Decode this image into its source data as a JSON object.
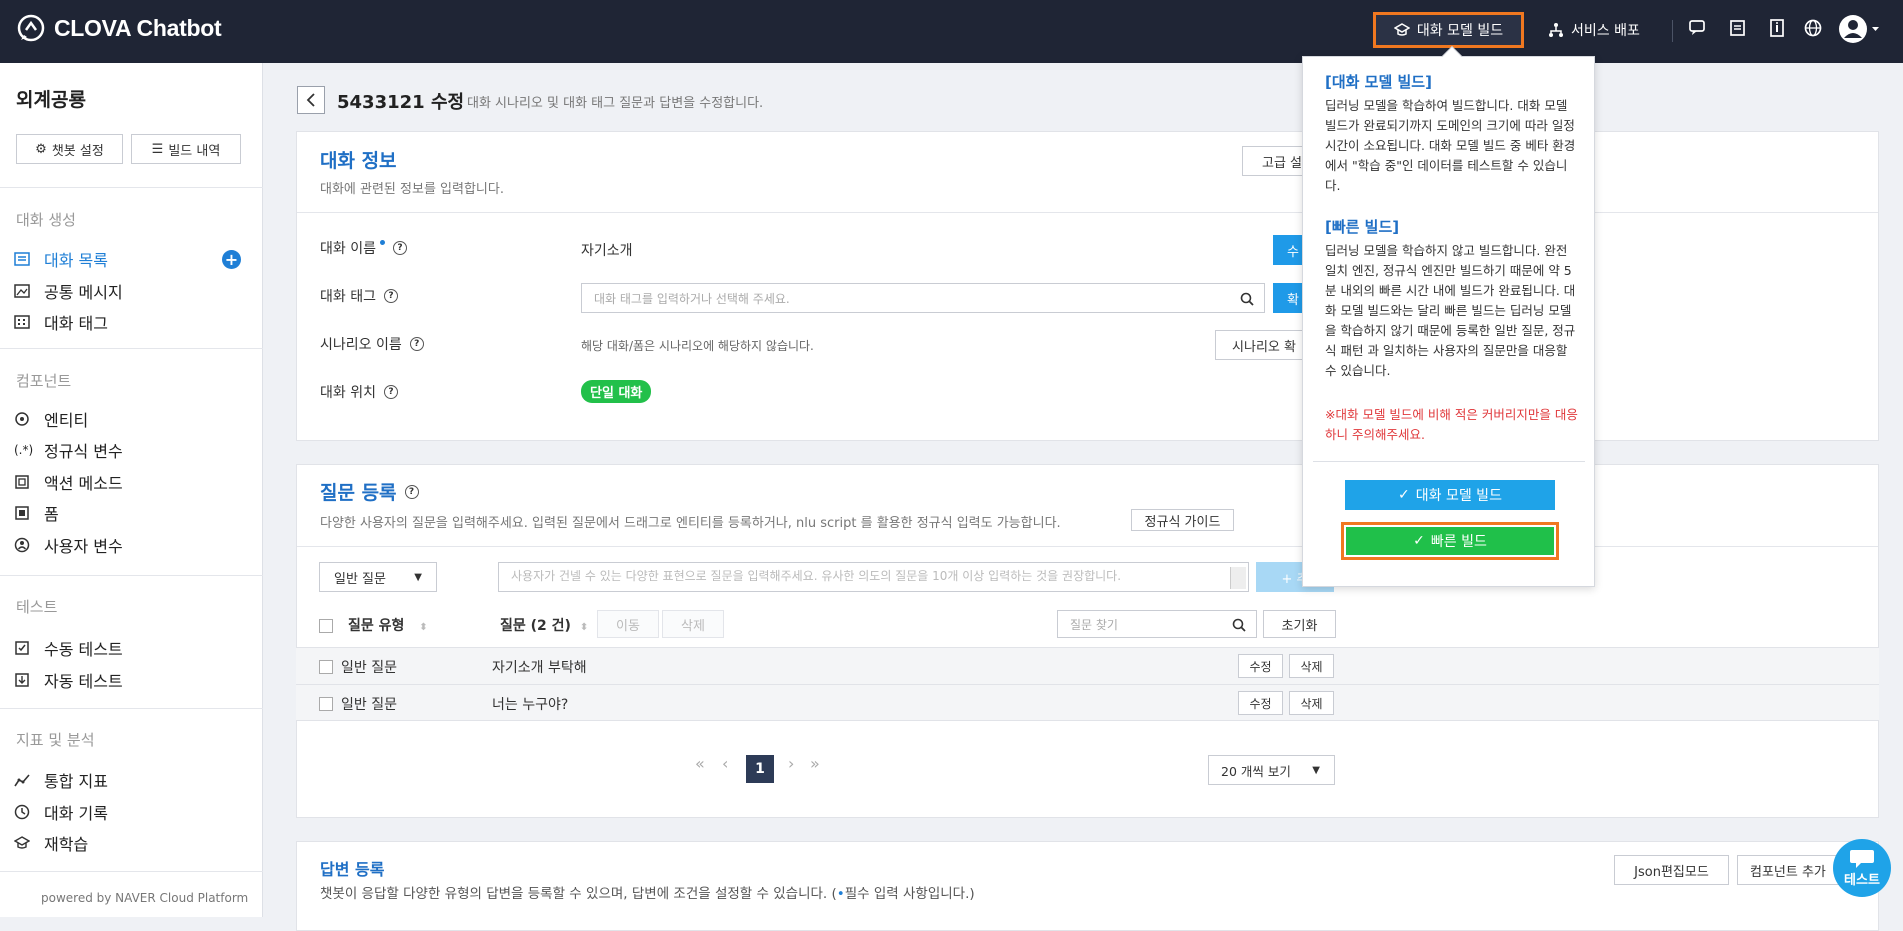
{
  "header": {
    "app_title": "CLOVA Chatbot",
    "build_label": "대화 모델 빌드",
    "deploy_label": "서비스 배포"
  },
  "sidebar": {
    "bot_name": "외계공룡",
    "settings_label": "챗봇 설정",
    "history_label": "빌드 내역",
    "sections": {
      "conversation": "대화 생성",
      "component": "컴포넌트",
      "test": "테스트",
      "analytics": "지표 및 분석"
    },
    "items": {
      "conv_list": "대화 목록",
      "common_msg": "공통 메시지",
      "conv_tag": "대화 태그",
      "entity": "엔티티",
      "regex_var": "정규식 변수",
      "action_method": "액션 메소드",
      "form": "폼",
      "user_var": "사용자 변수",
      "manual_test": "수동 테스트",
      "auto_test": "자동 테스트",
      "total_metrics": "통합 지표",
      "conv_log": "대화 기록",
      "retrain": "재학습"
    },
    "powered": "powered by NAVER Cloud Platform"
  },
  "page": {
    "title": "5433121 수정",
    "desc": "대화 시나리오 및 대화 태그 질문과 답변을 수정합니다."
  },
  "info": {
    "title": "대화 정보",
    "sub": "대화에 관련된 정보를 입력합니다.",
    "advanced_btn": "고급 설",
    "name_label": "대화 이름",
    "name_value": "자기소개",
    "name_btn": "수",
    "tag_label": "대화 태그",
    "tag_placeholder": "대화 태그를 입력하거나 선택해 주세요.",
    "tag_btn": "확",
    "scenario_label": "시나리오 이름",
    "scenario_value": "해당 대화/폼은 시나리오에 해당하지 않습니다.",
    "scenario_btn": "시나리오 확",
    "position_label": "대화 위치",
    "position_badge": "단일 대화"
  },
  "questions": {
    "title": "질문 등록",
    "sub": "다양한 사용자의 질문을 입력해주세요. 입력된 질문에서 드래그로 엔티티를 등록하거나, nlu script 를 활용한 정규식 입력도 가능합니다.",
    "regex_guide": "정규식 가이드",
    "type_select": "일반 질문",
    "input_placeholder": "사용자가 건넬 수 있는 다양한 표현으로 질문을 입력해주세요. 유사한 의도의 질문을 10개 이상 입력하는 것을 권장합니다.",
    "add_btn": "+ 추",
    "col_type": "질문 유형",
    "col_question": "질문 (2 건)",
    "move_btn": "이동",
    "delete_btn": "삭제",
    "search_placeholder": "질문 찾기",
    "reset_btn": "초기화",
    "rows": [
      {
        "type": "일반 질문",
        "text": "자기소개 부탁해",
        "edit": "수정",
        "delete": "삭제"
      },
      {
        "type": "일반 질문",
        "text": "너는 누구야?",
        "edit": "수정",
        "delete": "삭제"
      }
    ],
    "current_page": "1",
    "per_page": "20 개씩 보기"
  },
  "answers": {
    "title": "답변 등록",
    "sub_prefix": "챗봇이 응답할 다양한 유형의 답변을 등록할 수 있으며, 답변에 조건을 설정할 수 있습니다. (",
    "sub_suffix": "필수 입력 사항입니다.)",
    "json_btn": "Json편집모드",
    "component_btn": "컴포넌트 추가"
  },
  "popover": {
    "model_title": "[대화 모델 빌드]",
    "model_text": "딥러닝 모델을 학습하여 빌드합니다. 대화 모델 빌드가 완료되기까지 도메인의 크기에 따라 일정 시간이 소요됩니다. 대화 모델 빌드 중 베타 환경에서 \"학습 중\"인 데이터를 테스트할 수 있습니다.",
    "fast_title": "[빠른 빌드]",
    "fast_text": "딥러닝 모델을 학습하지 않고 빌드합니다. 완전 일치 엔진, 정규식 엔진만 빌드하기 때문에 약 5분 내외의 빠른 시간 내에 빌드가 완료됩니다. 대화 모델 빌드와는 달리 빠른 빌드는 딥러닝 모델을 학습하지 않기 때문에 등록한 일반 질문, 정규식 패턴 과 일치하는 사용자의 질문만을 대응할 수 있습니다.",
    "warning": "※대화 모델 빌드에 비해 적은 커버리지만을 대응하니 주의해주세요.",
    "model_btn": "대화 모델 빌드",
    "fast_btn": "빠른 빌드"
  },
  "chat_float": "테스트",
  "colors": {
    "accent": "#1f7fd6",
    "highlight": "#f07820",
    "green": "#20c04a"
  }
}
